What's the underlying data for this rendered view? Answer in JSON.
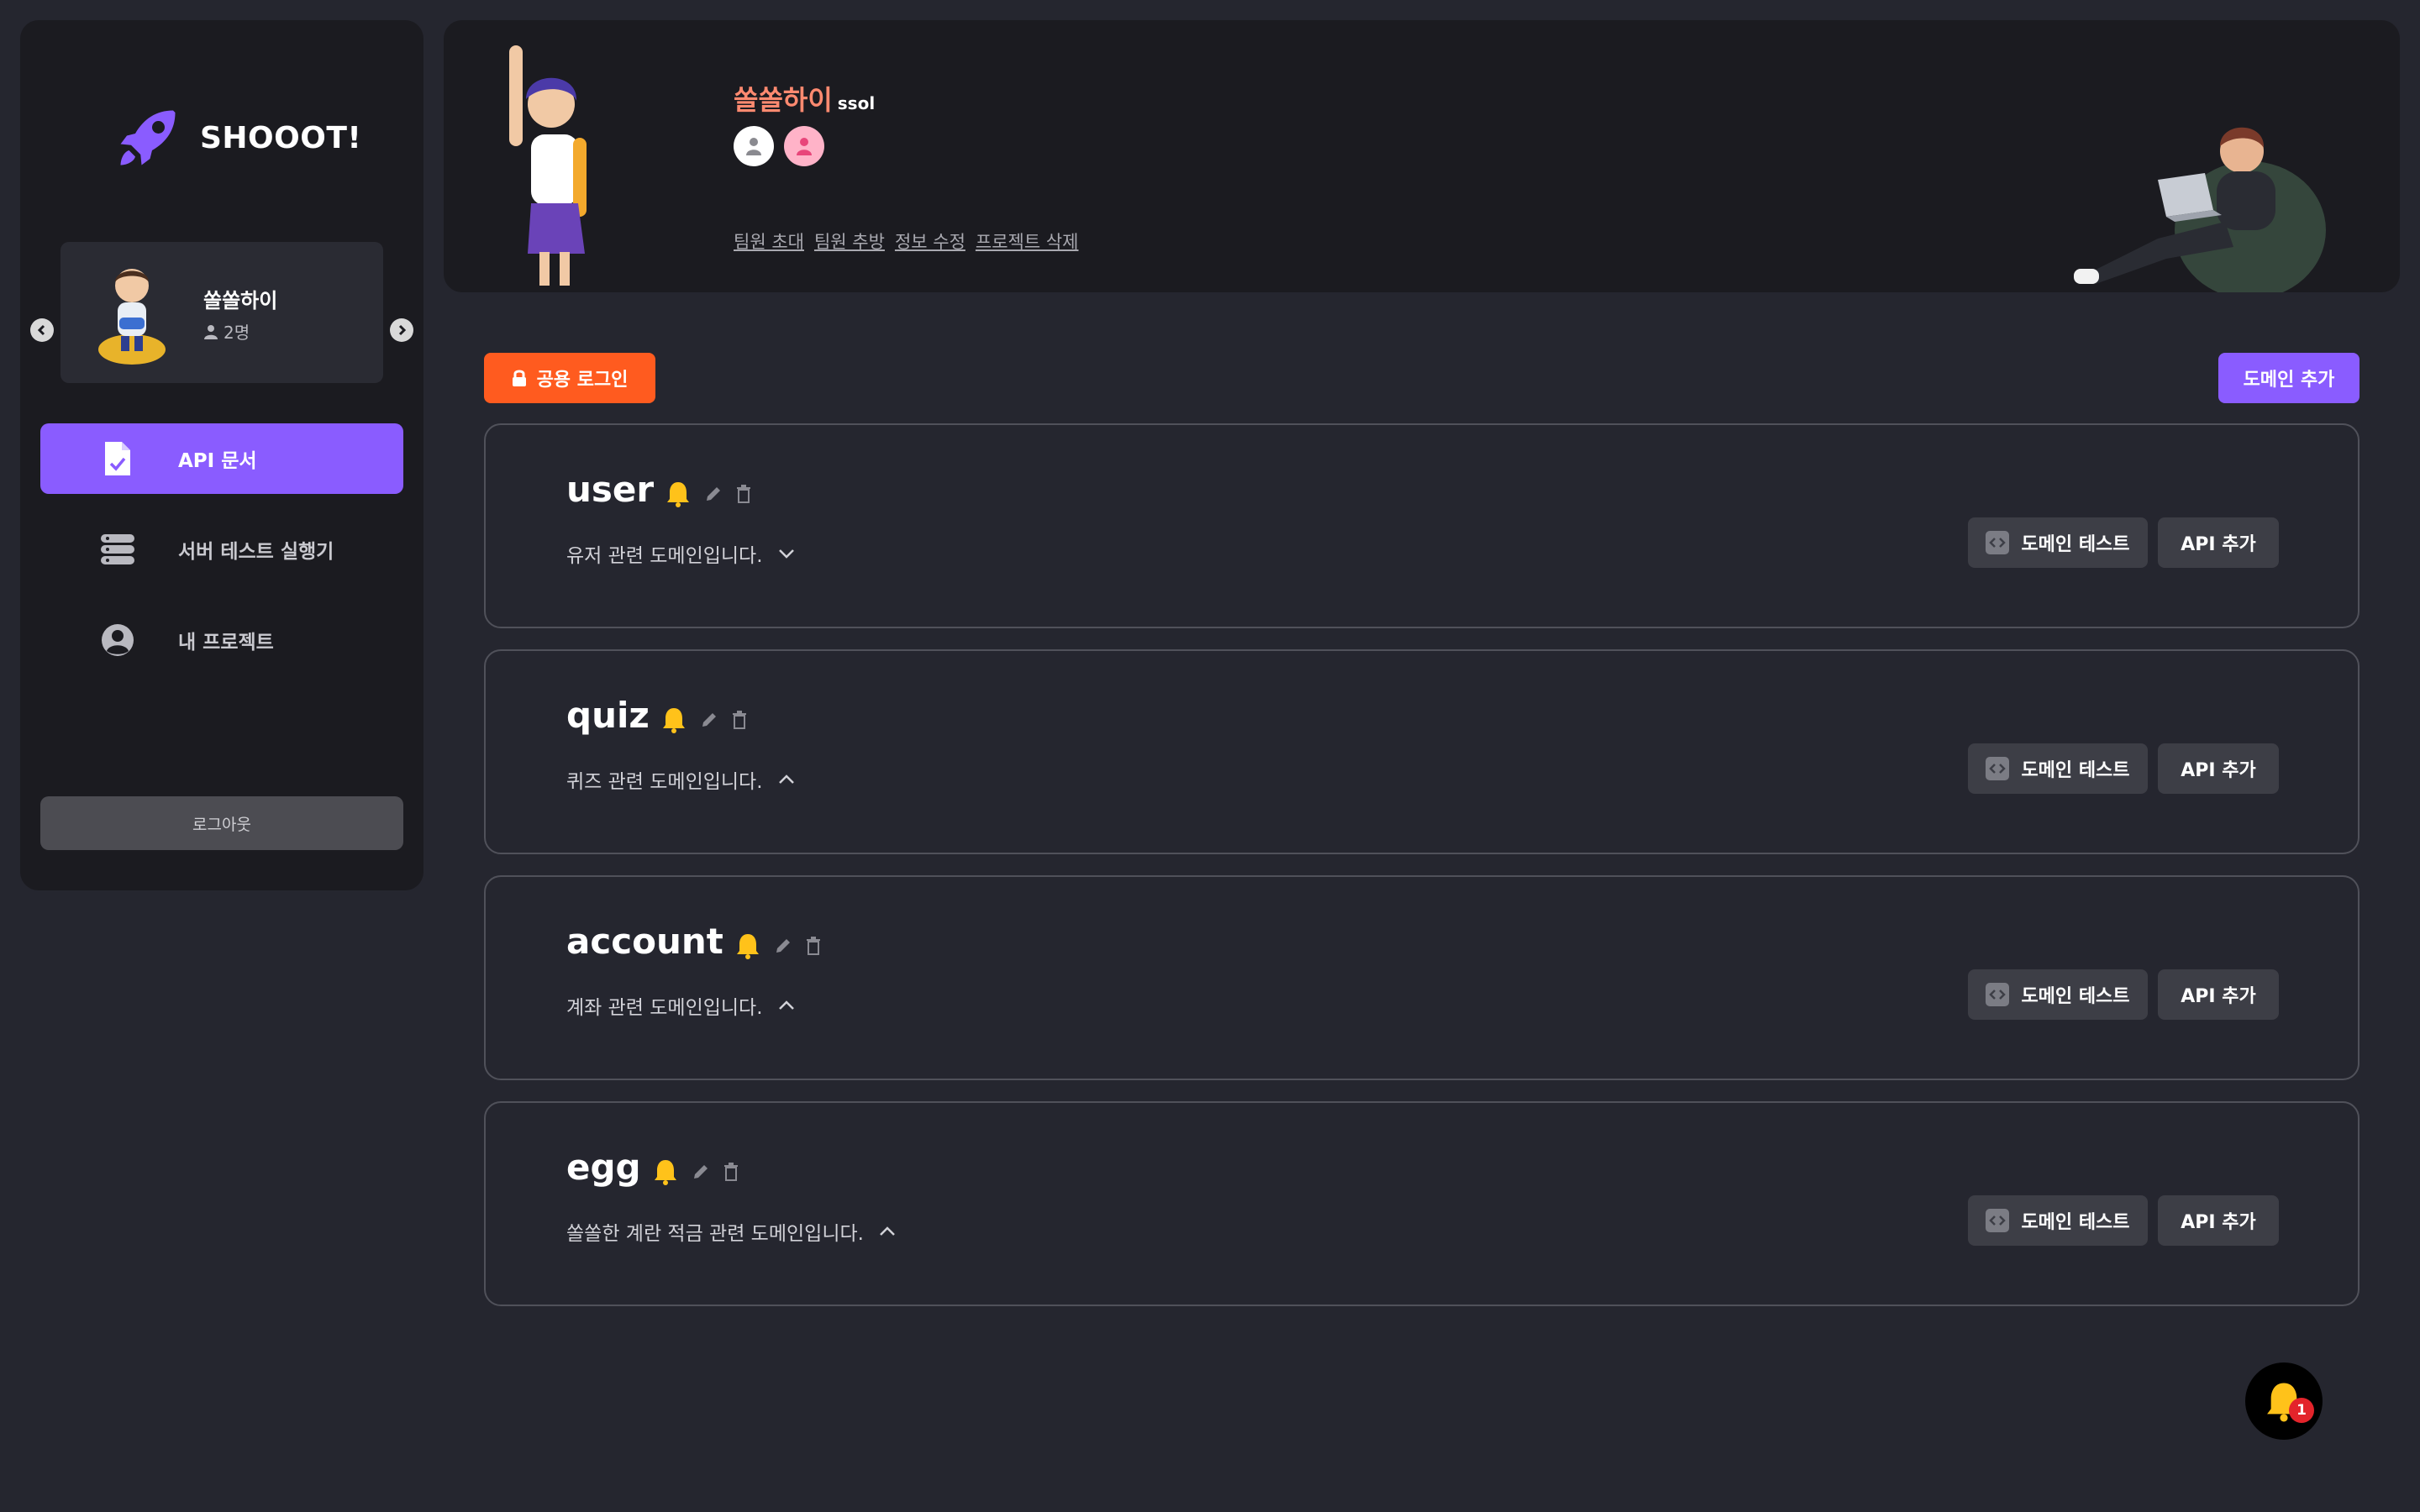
{
  "brand": {
    "name": "SHOOOT!",
    "icon": "rocket-icon"
  },
  "sidebar": {
    "project": {
      "name": "쏠쏠하이",
      "members": "2명"
    },
    "nav": [
      {
        "label": "API 문서",
        "icon": "document-check-icon",
        "active": true
      },
      {
        "label": "서버 테스트 실행기",
        "icon": "server-icon",
        "active": false
      },
      {
        "label": "내 프로젝트",
        "icon": "user-circle-icon",
        "active": false
      }
    ],
    "logout_label": "로그아웃"
  },
  "header": {
    "team_name": "쏠쏠하이",
    "team_handle": "ssol",
    "links": [
      "팀원 초대",
      "팀원 추방",
      "정보 수정",
      "프로젝트 삭제"
    ]
  },
  "actions": {
    "shared_login_label": "공용 로그인",
    "add_domain_label": "도메인 추가"
  },
  "domains": [
    {
      "name": "user",
      "description": "유저 관련 도메인입니다.",
      "expanded": false
    },
    {
      "name": "quiz",
      "description": "퀴즈 관련 도메인입니다.",
      "expanded": true
    },
    {
      "name": "account",
      "description": "계좌 관련 도메인입니다.",
      "expanded": true
    },
    {
      "name": "egg",
      "description": "쏠쏠한 계란 적금 관련 도메인입니다.",
      "expanded": true
    }
  ],
  "domain_buttons": {
    "test_label": "도메인 테스트",
    "api_add_label": "API 추가"
  },
  "notifications": {
    "count": "1"
  },
  "colors": {
    "accent": "#8a5cff",
    "orange": "#ff5b1f",
    "bell": "#ffc21a",
    "team_name": "#ff8a70"
  }
}
